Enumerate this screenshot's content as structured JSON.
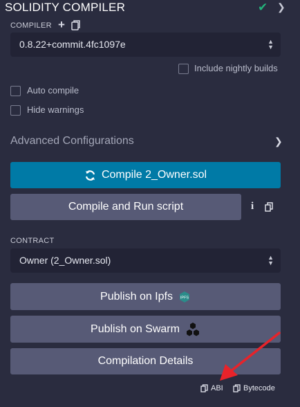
{
  "panel": {
    "title": "SOLIDITY COMPILER"
  },
  "compiler": {
    "label": "COMPILER",
    "selected_version": "0.8.22+commit.4fc1097e",
    "nightly_label": "Include nightly builds"
  },
  "options": {
    "auto_compile_label": "Auto compile",
    "hide_warnings_label": "Hide warnings"
  },
  "advanced": {
    "label": "Advanced Configurations"
  },
  "actions": {
    "compile_label": "Compile 2_Owner.sol",
    "compile_run_label": "Compile and Run script"
  },
  "contract": {
    "label": "CONTRACT",
    "selected": "Owner (2_Owner.sol)"
  },
  "publish": {
    "ipfs_label": "Publish on Ipfs",
    "ipfs_badge": "IPFS",
    "swarm_label": "Publish on Swarm",
    "details_label": "Compilation Details"
  },
  "copy": {
    "abi_label": "ABI",
    "bytecode_label": "Bytecode"
  },
  "colors": {
    "background": "#2a2c3f",
    "primary": "#007aa6",
    "secondary": "#575a76",
    "success": "#23b37a",
    "annotation_arrow": "#e8232a"
  }
}
